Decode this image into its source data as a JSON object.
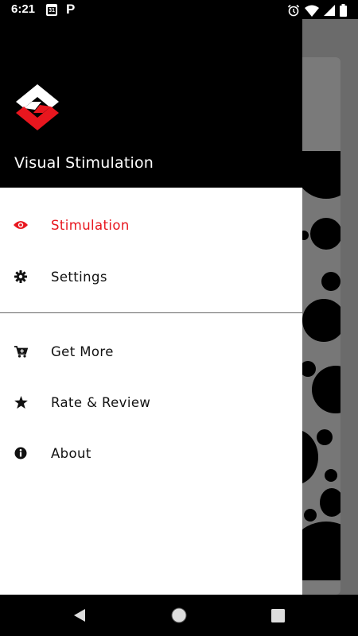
{
  "status_bar": {
    "time": "6:21",
    "calendar_day": "31",
    "parking_letter": "P",
    "icons": [
      "calendar-icon",
      "parking-icon",
      "alarm-icon",
      "wifi-icon",
      "signal-icon",
      "battery-icon"
    ]
  },
  "drawer": {
    "app_title": "Visual Stimulation",
    "accent_color": "#e8161e",
    "menu_primary": [
      {
        "label": "Stimulation",
        "icon": "eye-icon",
        "active": true
      },
      {
        "label": "Settings",
        "icon": "gear-icon",
        "active": false
      }
    ],
    "menu_secondary": [
      {
        "label": "Get More",
        "icon": "cart-icon"
      },
      {
        "label": "Rate & Review",
        "icon": "star-icon"
      },
      {
        "label": "About",
        "icon": "info-icon"
      }
    ]
  },
  "nav_bar": {
    "buttons": [
      "back-icon",
      "home-icon",
      "recents-icon"
    ]
  }
}
